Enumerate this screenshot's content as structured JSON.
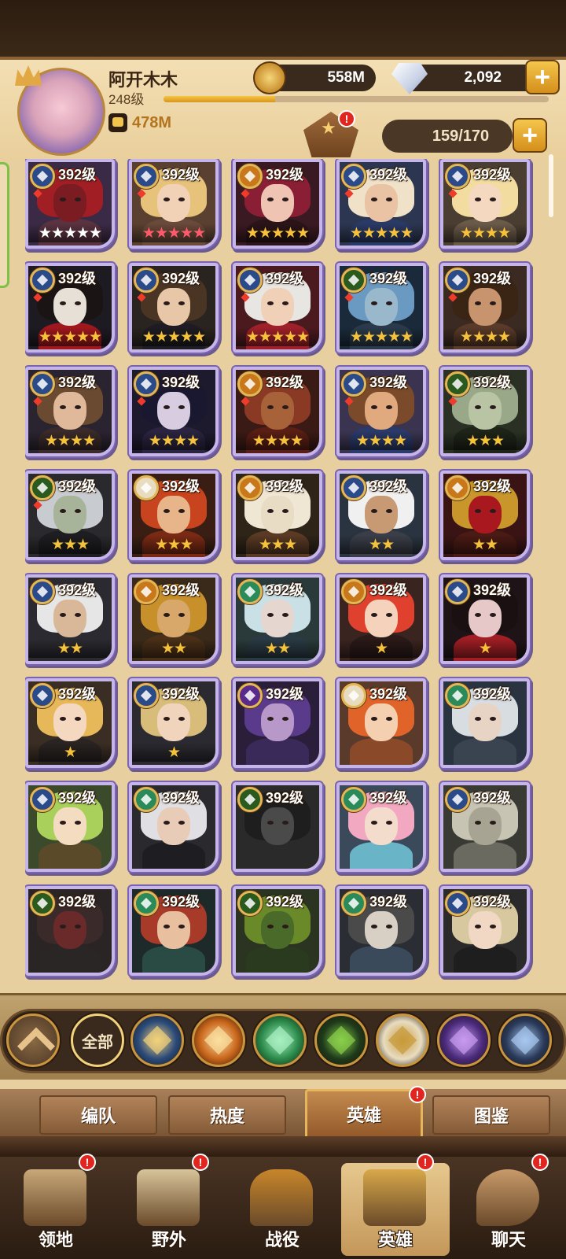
{
  "player": {
    "name": "阿开木木",
    "level": "248级",
    "xp_progress": 0.29,
    "power": "478M"
  },
  "resources": {
    "gold": "558M",
    "gems": "2,092",
    "plus": "+"
  },
  "hero_count": "159/170",
  "badge_mark": "!",
  "colors": {
    "accent_gold": "#f6c23a",
    "card_border": "#c6b5e8",
    "notification_red": "#e0261f"
  },
  "heroes": [
    {
      "level": "392级",
      "faction": "lightbearer",
      "stars": 5,
      "star_color": "white",
      "bg": "#3b2a45",
      "hair": "#a01e24",
      "skin": "#7b1b22",
      "body": "#5a3340"
    },
    {
      "level": "392级",
      "faction": "lightbearer",
      "stars": 5,
      "star_color": "red",
      "bg": "#5a4030",
      "hair": "#e6c27a",
      "skin": "#f2d2b6",
      "body": "#6a4a3a"
    },
    {
      "level": "392级",
      "faction": "wilder_gold",
      "stars": 5,
      "star_color": "gold",
      "bg": "#3a1a22",
      "hair": "#8a1e34",
      "skin": "#f0c4b2",
      "body": "#2a1418"
    },
    {
      "level": "392级",
      "faction": "lightbearer",
      "stars": 5,
      "star_color": "gold",
      "bg": "#2c3650",
      "hair": "#f0e2c8",
      "skin": "#e9c3a4",
      "body": "#2a3a66"
    },
    {
      "level": "392级",
      "faction": "lightbearer",
      "stars": 4,
      "star_color": "gold",
      "bg": "#4a3e32",
      "hair": "#f2dca0",
      "skin": "#f4d8c0",
      "body": "#6a5a48"
    },
    {
      "level": "392级",
      "faction": "lightbearer",
      "stars": 5,
      "star_color": "gold",
      "bg": "#1e1a22",
      "hair": "#1a1414",
      "skin": "#e6e0d6",
      "body": "#a0181e"
    },
    {
      "level": "392级",
      "faction": "lightbearer",
      "stars": 5,
      "star_color": "gold",
      "bg": "#2a2420",
      "hair": "#4a3424",
      "skin": "#e8c6a8",
      "body": "#1e1c22"
    },
    {
      "level": "392级",
      "faction": "lightbearer",
      "stars": 5,
      "star_color": "gold",
      "bg": "#4a1a1e",
      "hair": "#e8e6e2",
      "skin": "#f0d0b6",
      "body": "#a0202a"
    },
    {
      "level": "392级",
      "faction": "graveborn",
      "stars": 5,
      "star_color": "gold",
      "bg": "#1a2a3a",
      "hair": "#6a9ac2",
      "skin": "#9ab8cc",
      "body": "#2a3a4a"
    },
    {
      "level": "392级",
      "faction": "lightbearer",
      "stars": 4,
      "star_color": "gold",
      "bg": "#3a2a22",
      "hair": "#3a2414",
      "skin": "#c8946e",
      "body": "#5a3a28"
    },
    {
      "level": "392级",
      "faction": "lightbearer",
      "stars": 4,
      "star_color": "gold",
      "bg": "#2a2430",
      "hair": "#6a4a30",
      "skin": "#e0b89a",
      "body": "#3a2a2a"
    },
    {
      "level": "392级",
      "faction": "lightbearer",
      "stars": 4,
      "star_color": "gold",
      "bg": "#1e1a2e",
      "hair": "#1a1830",
      "skin": "#d8cce0",
      "body": "#2a2440"
    },
    {
      "level": "392级",
      "faction": "wilder_gold",
      "stars": 4,
      "star_color": "gold",
      "bg": "#3a1a14",
      "hair": "#8a3a24",
      "skin": "#a8623a",
      "body": "#5a1e14"
    },
    {
      "level": "392级",
      "faction": "lightbearer",
      "stars": 4,
      "star_color": "gold",
      "bg": "#3a3450",
      "hair": "#7a4a2a",
      "skin": "#e0aa7e",
      "body": "#2a3a6a"
    },
    {
      "level": "392级",
      "faction": "graveborn",
      "stars": 3,
      "star_color": "gold",
      "bg": "#2a3024",
      "hair": "#9aa88a",
      "skin": "#b8c4a4",
      "body": "#1e2418"
    },
    {
      "level": "392级",
      "faction": "graveborn",
      "stars": 3,
      "star_color": "gold",
      "bg": "#2a2a2e",
      "hair": "#c8ccd0",
      "skin": "#a8b49a",
      "body": "#1e1e22"
    },
    {
      "level": "392级",
      "faction": "celestial",
      "stars": 3,
      "star_color": "gold",
      "bg": "#3a1e14",
      "hair": "#c8441e",
      "skin": "#e8b48a",
      "body": "#7a2a14"
    },
    {
      "level": "392级",
      "faction": "wilder_gold",
      "stars": 3,
      "star_color": "gold",
      "bg": "#2e2418",
      "hair": "#f0e6d4",
      "skin": "#e8dcc4",
      "body": "#5a3a24"
    },
    {
      "level": "392级",
      "faction": "lightbearer",
      "stars": 2,
      "star_color": "gold",
      "bg": "#2a3440",
      "hair": "#f0f0f0",
      "skin": "#c89a74",
      "body": "#3a3e48"
    },
    {
      "level": "392级",
      "faction": "wilder_gold",
      "stars": 2,
      "star_color": "gold",
      "bg": "#3a1414",
      "hair": "#c8962a",
      "skin": "#a8181e",
      "body": "#4a1a14"
    },
    {
      "level": "392级",
      "faction": "lightbearer",
      "stars": 2,
      "star_color": "gold",
      "bg": "#2a2a30",
      "hair": "#e6e6e6",
      "skin": "#d8b898",
      "body": "#2a2a30"
    },
    {
      "level": "392级",
      "faction": "wilder_gold",
      "stars": 2,
      "star_color": "gold",
      "bg": "#3a2a1a",
      "hair": "#c8902a",
      "skin": "#d8a86a",
      "body": "#4a3018"
    },
    {
      "level": "392级",
      "faction": "wilder",
      "stars": 2,
      "star_color": "gold",
      "bg": "#2a3a3a",
      "hair": "#c8e0e6",
      "skin": "#e6d6d0",
      "body": "#2a3a44"
    },
    {
      "level": "392级",
      "faction": "wilder_gold",
      "stars": 1,
      "star_color": "gold",
      "bg": "#3a2420",
      "hair": "#e0402e",
      "skin": "#f4d2bc",
      "body": "#2a1a18"
    },
    {
      "level": "392级",
      "faction": "lightbearer",
      "stars": 1,
      "star_color": "gold",
      "bg": "#1e1418",
      "hair": "#1a1012",
      "skin": "#e6c8c8",
      "body": "#a01e24"
    },
    {
      "level": "392级",
      "faction": "lightbearer",
      "stars": 1,
      "star_color": "gold",
      "bg": "#3a2e24",
      "hair": "#e6b85a",
      "skin": "#f4d8c0",
      "body": "#2a2422"
    },
    {
      "level": "392级",
      "faction": "lightbearer",
      "stars": 1,
      "star_color": "gold",
      "bg": "#2a2a30",
      "hair": "#d8bc7a",
      "skin": "#f0d4bc",
      "body": "#2a2a30"
    },
    {
      "level": "392级",
      "faction": "dimensional",
      "stars": 0,
      "star_color": "gold",
      "bg": "#2a1e3a",
      "hair": "#5a3a8a",
      "skin": "#b898c8",
      "body": "#3a2a5a"
    },
    {
      "level": "392级",
      "faction": "celestial",
      "stars": 0,
      "star_color": "gold",
      "bg": "#5a3a2a",
      "hair": "#e0642a",
      "skin": "#f4cfb0",
      "body": "#8a4a2a"
    },
    {
      "level": "392级",
      "faction": "wilder",
      "stars": 0,
      "star_color": "gold",
      "bg": "#2a3440",
      "hair": "#d8dde2",
      "skin": "#e8d4c4",
      "body": "#3a4450"
    },
    {
      "level": "392级",
      "faction": "lightbearer",
      "stars": 0,
      "star_color": "gold",
      "bg": "#3a4a2a",
      "hair": "#a8d05a",
      "skin": "#f4dcc0",
      "body": "#5a4a2a"
    },
    {
      "level": "392级",
      "faction": "wilder",
      "stars": 0,
      "star_color": "gold",
      "bg": "#2a2a2e",
      "hair": "#e0e0e4",
      "skin": "#e8ccb8",
      "body": "#1e1e22"
    },
    {
      "level": "392级",
      "faction": "graveborn",
      "stars": 0,
      "star_color": "gold",
      "bg": "#2a2a2a",
      "hair": "#1e1e1e",
      "skin": "#4a4a4a",
      "body": "#2a2a2a"
    },
    {
      "level": "392级",
      "faction": "wilder",
      "stars": 0,
      "star_color": "gold",
      "bg": "#3a4a5a",
      "hair": "#f2a8c0",
      "skin": "#f4dccc",
      "body": "#6ab4c8"
    },
    {
      "level": "392级",
      "faction": "lightbearer",
      "stars": 0,
      "star_color": "gold",
      "bg": "#3a3a34",
      "hair": "#c8c4b4",
      "skin": "#a8a494",
      "body": "#6a6a60"
    },
    {
      "level": "392级",
      "faction": "graveborn",
      "stars": 0,
      "star_color": "gold",
      "bg": "#2a2424",
      "hair": "#3a2a2a",
      "skin": "#6a2a2a",
      "body": "#2a2626"
    },
    {
      "level": "392级",
      "faction": "wilder",
      "stars": 0,
      "star_color": "gold",
      "bg": "#1e2a2a",
      "hair": "#a83a2a",
      "skin": "#e8c0a0",
      "body": "#2a4a44"
    },
    {
      "level": "392级",
      "faction": "graveborn",
      "stars": 0,
      "star_color": "gold",
      "bg": "#2a3420",
      "hair": "#6a8a2a",
      "skin": "#4a6a2a",
      "body": "#2a3a1e"
    },
    {
      "level": "392级",
      "faction": "wilder",
      "stars": 0,
      "star_color": "gold",
      "bg": "#2a2e34",
      "hair": "#4a4a4a",
      "skin": "#d8d0c4",
      "body": "#3a4a5a"
    },
    {
      "level": "392级",
      "faction": "lightbearer",
      "stars": 0,
      "star_color": "gold",
      "bg": "#2a2a2a",
      "hair": "#d8c8a0",
      "skin": "#f0d8c4",
      "body": "#1e1e1e"
    }
  ],
  "faction_filter": {
    "all_label": "全部",
    "factions": [
      {
        "name": "lightbearer-icon",
        "color": "#2a4a7a",
        "glyph": "#f2d27a"
      },
      {
        "name": "mauler-icon",
        "color": "#c8641a",
        "glyph": "#fbe0a0"
      },
      {
        "name": "wilder-icon",
        "color": "#2a8a4a",
        "glyph": "#a8f0c0"
      },
      {
        "name": "graveborn-icon",
        "color": "#1e3a1a",
        "glyph": "#8ad04a"
      },
      {
        "name": "celestial-icon",
        "color": "#e8dcc0",
        "glyph": "#c89a3a"
      },
      {
        "name": "hypogean-icon",
        "color": "#4a2a7a",
        "glyph": "#c89af0"
      },
      {
        "name": "dimensional-icon",
        "color": "#2a3a5a",
        "glyph": "#a8c8f0"
      }
    ]
  },
  "tabs": [
    {
      "label": "编队",
      "active": false
    },
    {
      "label": "热度",
      "active": false
    },
    {
      "label": "英雄",
      "active": true
    },
    {
      "label": "图鉴",
      "active": false
    }
  ],
  "nav": [
    {
      "label": "领地",
      "icon": "castle-icon",
      "active": false
    },
    {
      "label": "野外",
      "icon": "scroll-map-icon",
      "active": false
    },
    {
      "label": "战役",
      "icon": "sword-crest-icon",
      "active": false
    },
    {
      "label": "英雄",
      "icon": "hero-helmet-icon",
      "active": true
    },
    {
      "label": "聊天",
      "icon": "chat-bubble-icon",
      "active": false
    }
  ]
}
